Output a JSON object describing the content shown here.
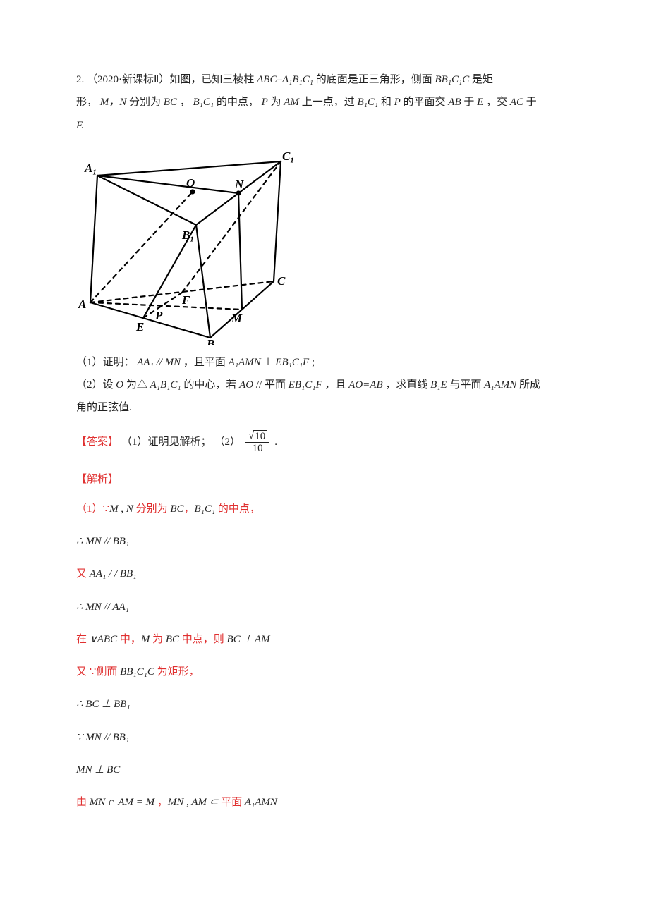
{
  "problem": {
    "number": "2.",
    "source": "（2020·新课标Ⅱ）如图，已知三棱柱 ",
    "prismLabel": "ABC–A₁B₁C₁",
    "afterPrism": " 的底面是正三角形，侧面 ",
    "sideFace": "BB₁C₁C",
    "afterSide": " 是矩",
    "line2a": "形，",
    "mn": "M，N",
    "line2b": " 分别为 ",
    "bc": "BC",
    "comma": "，",
    "b1c1": "B₁C₁",
    "line2c": " 的中点，",
    "p": "P",
    "line2d": " 为 ",
    "am": "AM",
    "line2e": " 上一点，过 ",
    "b1c1_2": "B₁C₁",
    "line2f": " 和 ",
    "p2": "P",
    "line2g": " 的平面交 ",
    "ab": "AB",
    "line2h": " 于 ",
    "e": "E",
    "line2i": "，交 ",
    "ac": "AC",
    "line2j": " 于",
    "line3": "F.",
    "q1a": "（1）证明：",
    "q1_aa1mn": "AA₁ // MN",
    "q1b": "，且平面 ",
    "q1_a1amn": "A₁AMN",
    "q1c": "⊥",
    "q1_eb1c1f": "EB₁C₁F",
    "q1d": ";",
    "q2a": "（2）设 ",
    "q2_o": "O",
    "q2b": " 为△",
    "q2_a1b1c1": "A₁B₁C₁",
    "q2c": " 的中心，若 ",
    "q2_ao": "AO",
    "q2d": "// 平面 ",
    "q2_eb1c1f": "EB₁C₁F",
    "q2e": "，且 ",
    "q2_aoab": "AO=AB",
    "q2f": "，求直线 ",
    "q2_b1e": "B₁E",
    "q2g": " 与平面 ",
    "q2_a1amn": "A₁AMN",
    "q2h": " 所成",
    "q2i": "角的正弦值."
  },
  "figureLabels": {
    "A1": "A₁",
    "C1": "C₁",
    "O": "O",
    "N": "N",
    "B1": "B₁",
    "C": "C",
    "A": "A",
    "E": "E",
    "P": "P",
    "F": "F",
    "M": "M",
    "B": "B"
  },
  "answer": {
    "label1": "【答案】",
    "part1": "（1）证明见解析；",
    "part2": "（2）",
    "frac_num": "10",
    "frac_den": "10",
    "period": "."
  },
  "solution": {
    "label": "【解析】",
    "lines": [
      {
        "segs": [
          {
            "t": "（1）",
            "c": "red"
          },
          {
            "t": "∵",
            "c": "red",
            "f": "m"
          },
          {
            "t": "M , N ",
            "c": "blk",
            "f": "i"
          },
          {
            "t": "分别为 ",
            "c": "red"
          },
          {
            "t": "BC",
            "c": "blk",
            "f": "i"
          },
          {
            "t": "，",
            "c": "red"
          },
          {
            "t": "B₁C₁ ",
            "c": "blk",
            "f": "i"
          },
          {
            "t": "的中点，",
            "c": "red"
          }
        ]
      },
      {
        "segs": [
          {
            "t": "∴ MN // BB₁",
            "c": "blk",
            "f": "i"
          }
        ]
      },
      {
        "segs": [
          {
            "t": "又 ",
            "c": "red"
          },
          {
            "t": "AA₁ / / BB₁",
            "c": "blk",
            "f": "i"
          }
        ]
      },
      {
        "segs": [
          {
            "t": "∴ MN // AA₁",
            "c": "blk",
            "f": "i"
          }
        ]
      },
      {
        "segs": [
          {
            "t": "在 ",
            "c": "red"
          },
          {
            "t": "∨ABC ",
            "c": "blk",
            "f": "i"
          },
          {
            "t": "中，",
            "c": "red"
          },
          {
            "t": "M ",
            "c": "blk",
            "f": "i"
          },
          {
            "t": "为 ",
            "c": "red"
          },
          {
            "t": "BC ",
            "c": "blk",
            "f": "i"
          },
          {
            "t": "中点，则 ",
            "c": "red"
          },
          {
            "t": "BC ⊥ AM",
            "c": "blk",
            "f": "i"
          }
        ]
      },
      {
        "segs": [
          {
            "t": "又 ",
            "c": "red"
          },
          {
            "t": "∵",
            "c": "red",
            "f": "m"
          },
          {
            "t": "侧面 ",
            "c": "red"
          },
          {
            "t": "BB₁C₁C ",
            "c": "blk",
            "f": "i"
          },
          {
            "t": "为矩形，",
            "c": "red"
          }
        ]
      },
      {
        "segs": [
          {
            "t": "∴ BC ⊥ BB₁",
            "c": "blk",
            "f": "i"
          }
        ]
      },
      {
        "segs": [
          {
            "t": "∵ MN // BB₁",
            "c": "blk",
            "f": "i"
          }
        ]
      },
      {
        "segs": [
          {
            "t": "MN ⊥ BC",
            "c": "blk",
            "f": "i"
          }
        ]
      },
      {
        "segs": [
          {
            "t": "由 ",
            "c": "red"
          },
          {
            "t": "MN ∩ AM = M",
            "c": "blk",
            "f": "i"
          },
          {
            "t": " ，",
            "c": "red"
          },
          {
            "t": "MN , AM ⊂ ",
            "c": "blk",
            "f": "i"
          },
          {
            "t": "平面 ",
            "c": "red"
          },
          {
            "t": "A₁AMN",
            "c": "blk",
            "f": "i"
          }
        ]
      }
    ]
  }
}
